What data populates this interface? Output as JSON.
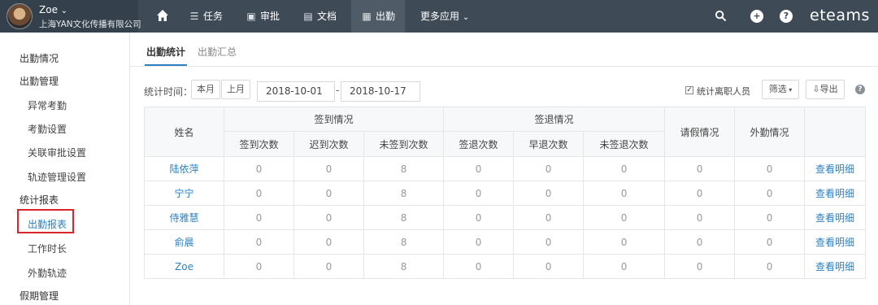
{
  "topbar": {
    "user_name": "Zoe",
    "company": "上海YAN文化传播有限公司",
    "nav": [
      {
        "label": "任务",
        "icon": "list-icon"
      },
      {
        "label": "审批",
        "icon": "approval-icon"
      },
      {
        "label": "文档",
        "icon": "document-icon"
      },
      {
        "label": "出勤",
        "icon": "attendance-icon"
      },
      {
        "label": "更多应用",
        "icon": "chevron-down-icon"
      }
    ],
    "brand": "eteams"
  },
  "sidebar": {
    "items": [
      {
        "label": "出勤情况"
      },
      {
        "label": "出勤管理"
      },
      {
        "label": "异常考勤"
      },
      {
        "label": "考勤设置"
      },
      {
        "label": "关联审批设置"
      },
      {
        "label": "轨迹管理设置"
      },
      {
        "label": "统计报表"
      },
      {
        "label": "出勤报表"
      },
      {
        "label": "工作时长"
      },
      {
        "label": "外勤轨迹"
      },
      {
        "label": "假期管理"
      }
    ]
  },
  "tabs": [
    {
      "label": "出勤统计",
      "active": true
    },
    {
      "label": "出勤汇总",
      "active": false
    }
  ],
  "filter": {
    "label": "统计时间：",
    "this_month": "本月",
    "last_month": "上月",
    "start_date": "2018-10-01",
    "end_date": "2018-10-17",
    "dash": "-",
    "include_resigned_label": "统计离职人员",
    "include_resigned_checked": true,
    "filter_button": "筛选",
    "export_button": "导出",
    "help": "?"
  },
  "table": {
    "headers": {
      "name": "姓名",
      "signin_group": "签到情况",
      "signout_group": "签退情况",
      "leave": "请假情况",
      "field": "外勤情况",
      "signin_count": "签到次数",
      "late_count": "迟到次数",
      "not_signin_count": "未签到次数",
      "signout_count": "签退次数",
      "early_count": "早退次数",
      "not_signout_count": "未签退次数"
    },
    "rows": [
      {
        "name": "陆依萍",
        "v": [
          "0",
          "0",
          "8",
          "0",
          "0",
          "0",
          "0",
          "0"
        ],
        "link": "查看明细"
      },
      {
        "name": "宁宁",
        "v": [
          "0",
          "0",
          "8",
          "0",
          "0",
          "0",
          "0",
          "0"
        ],
        "link": "查看明细"
      },
      {
        "name": "侍雅慧",
        "v": [
          "0",
          "0",
          "8",
          "0",
          "0",
          "0",
          "0",
          "0"
        ],
        "link": "查看明细"
      },
      {
        "name": "俞晨",
        "v": [
          "0",
          "0",
          "8",
          "0",
          "0",
          "0",
          "0",
          "0"
        ],
        "link": "查看明细"
      },
      {
        "name": "Zoe",
        "v": [
          "0",
          "0",
          "8",
          "0",
          "0",
          "0",
          "0",
          "0"
        ],
        "link": "查看明细"
      }
    ]
  },
  "colors": {
    "topbar": "#3e4a56",
    "accent": "#2f80c2",
    "highlight": "#d9262c"
  }
}
